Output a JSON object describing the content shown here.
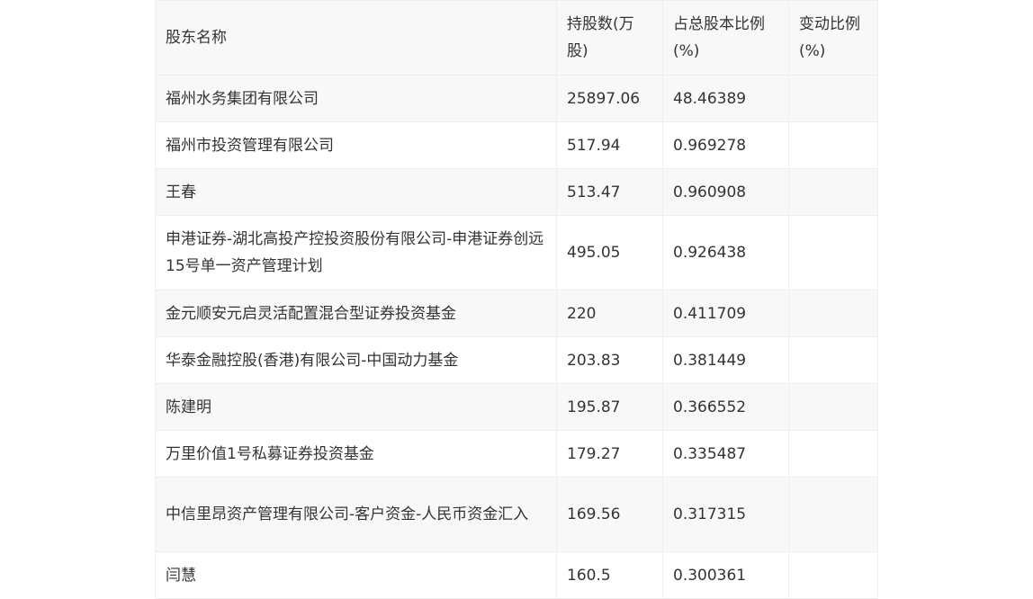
{
  "table": {
    "headers": [
      "股东名称",
      "持股数(万股)",
      "占总股本比例(%)",
      "变动比例(%)"
    ],
    "rows": [
      {
        "name": "福州水务集团有限公司",
        "shares": "25897.06",
        "ratio": "48.46389",
        "change": ""
      },
      {
        "name": "福州市投资管理有限公司",
        "shares": "517.94",
        "ratio": "0.969278",
        "change": ""
      },
      {
        "name": "王春",
        "shares": "513.47",
        "ratio": "0.960908",
        "change": ""
      },
      {
        "name": "申港证券-湖北高投产控投资股份有限公司-申港证券创远15号单一资产管理计划",
        "shares": "495.05",
        "ratio": "0.926438",
        "change": ""
      },
      {
        "name": "金元顺安元启灵活配置混合型证券投资基金",
        "shares": "220",
        "ratio": "0.411709",
        "change": ""
      },
      {
        "name": "华泰金融控股(香港)有限公司-中国动力基金",
        "shares": "203.83",
        "ratio": "0.381449",
        "change": ""
      },
      {
        "name": "陈建明",
        "shares": "195.87",
        "ratio": "0.366552",
        "change": ""
      },
      {
        "name": "万里价值1号私募证券投资基金",
        "shares": "179.27",
        "ratio": "0.335487",
        "change": ""
      },
      {
        "name": "中信里昂资产管理有限公司-客户资金-人民币资金汇入",
        "shares": "169.56",
        "ratio": "0.317315",
        "change": ""
      },
      {
        "name": "闫慧",
        "shares": "160.5",
        "ratio": "0.300361",
        "change": ""
      }
    ]
  }
}
